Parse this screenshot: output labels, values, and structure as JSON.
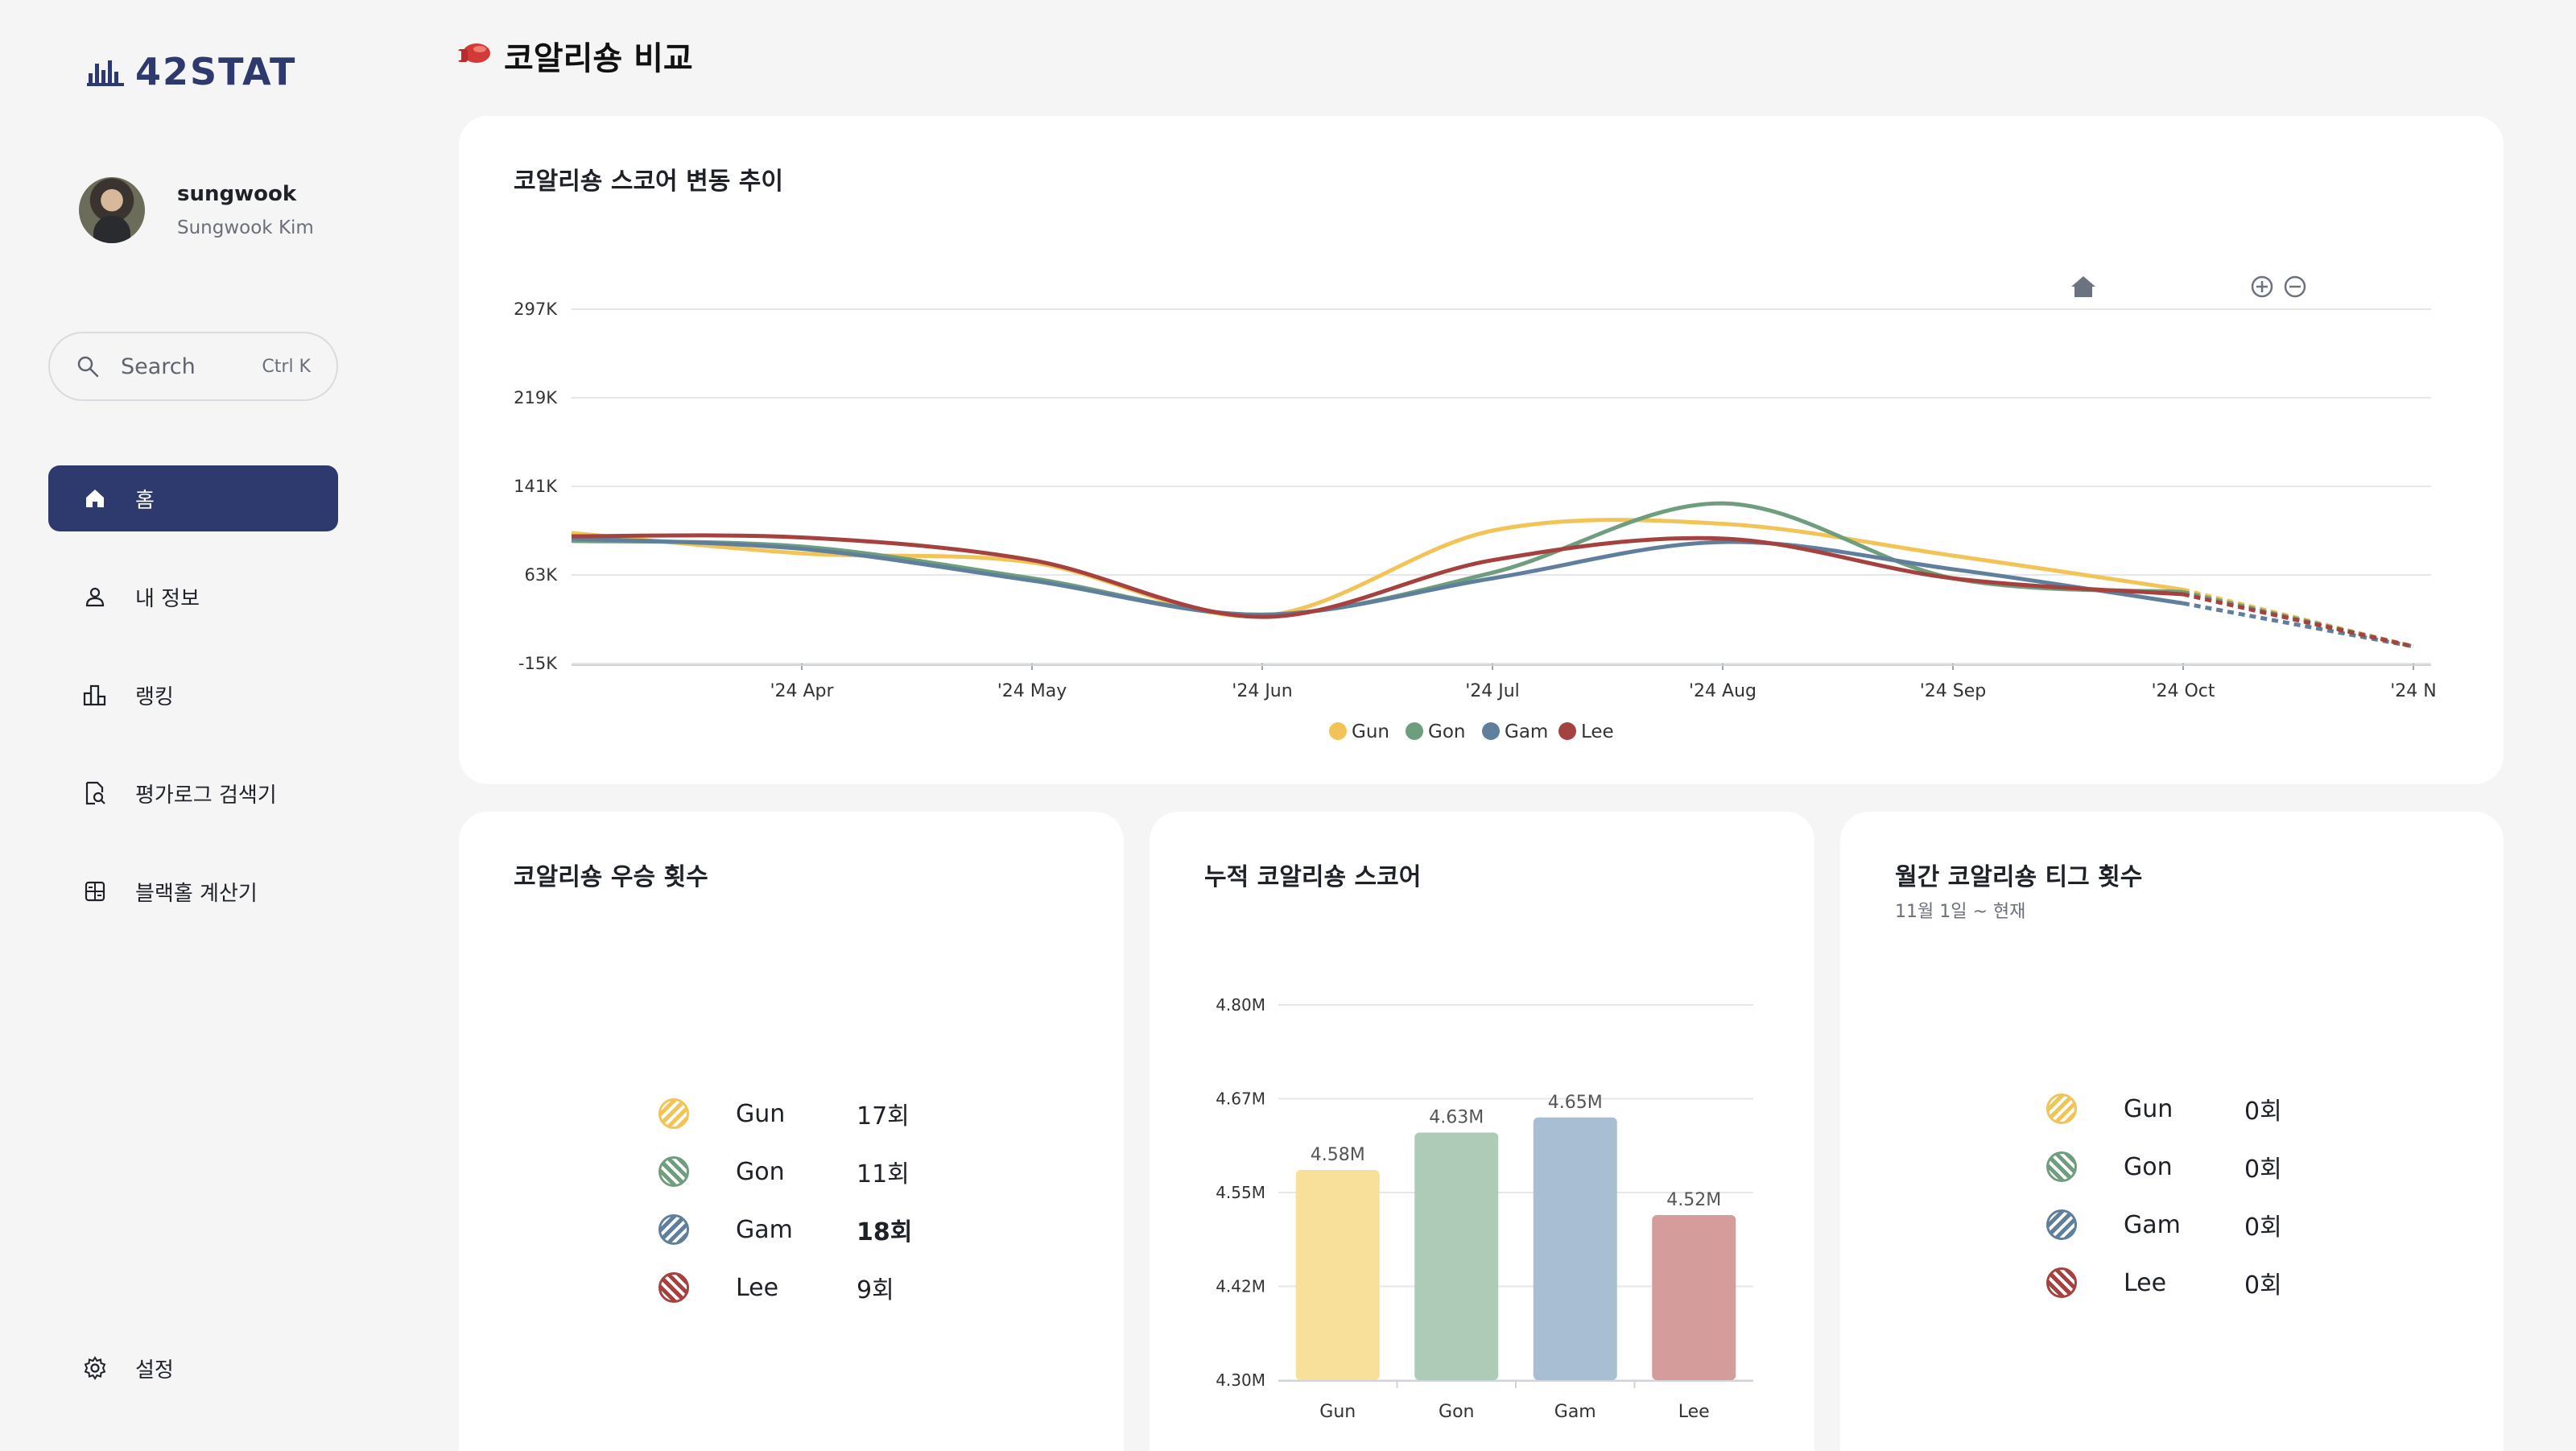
{
  "brand": {
    "name": "42STAT"
  },
  "profile": {
    "username": "sungwook",
    "fullname": "Sungwook Kim"
  },
  "search": {
    "label": "Search",
    "shortcut": "Ctrl K"
  },
  "nav": [
    {
      "label": "홈",
      "icon": "home-icon",
      "active": true
    },
    {
      "label": "내 정보",
      "icon": "user-icon",
      "active": false
    },
    {
      "label": "랭킹",
      "icon": "ranking-icon",
      "active": false
    },
    {
      "label": "평가로그 검색기",
      "icon": "log-search-icon",
      "active": false
    },
    {
      "label": "블랙홀 계산기",
      "icon": "calculator-icon",
      "active": false
    }
  ],
  "settings": {
    "label": "설정",
    "icon": "gear-icon"
  },
  "page": {
    "title": "코알리숑 비교",
    "icon": "boxing-glove-icon"
  },
  "colors": {
    "Gun": "#f2c457",
    "Gon": "#6f9e7e",
    "Gam": "#5f7f9c",
    "Lee": "#a5413e",
    "accent": "#2e3a6e"
  },
  "trend_card": {
    "title": "코알리숑 스코어 변동 추이",
    "toolbar": {
      "zoom_in": "zoom-in-icon",
      "zoom_out": "zoom-out-icon",
      "reset": "home-icon"
    }
  },
  "wins_card": {
    "title": "코알리숑 우승 횟수",
    "rows": [
      {
        "name": "Gun",
        "value": "17회",
        "bold": false
      },
      {
        "name": "Gon",
        "value": "11회",
        "bold": false
      },
      {
        "name": "Gam",
        "value": "18회",
        "bold": true
      },
      {
        "name": "Lee",
        "value": "9회",
        "bold": false
      }
    ]
  },
  "score_card": {
    "title": "누적 코알리숑 스코어"
  },
  "tig_card": {
    "title": "월간 코알리숑 티그 횟수",
    "subtitle": "11월 1일 ~ 현재",
    "rows": [
      {
        "name": "Gun",
        "value": "0회"
      },
      {
        "name": "Gon",
        "value": "0회"
      },
      {
        "name": "Gam",
        "value": "0회"
      },
      {
        "name": "Lee",
        "value": "0회"
      }
    ]
  },
  "chart_data": [
    {
      "type": "line",
      "title": "코알리숑 스코어 변동 추이",
      "x_tick_labels": [
        "'24 Apr",
        "'24 May",
        "'24 Jun",
        "'24 Jul",
        "'24 Aug",
        "'24 Sep",
        "'24 Oct",
        "'24 N"
      ],
      "y_tick_labels": [
        "297K",
        "219K",
        "141K",
        "63K",
        "-15K"
      ],
      "ylim": [
        -15000,
        297000
      ],
      "grid": true,
      "legend": "bottom",
      "x": [
        "2024-03-01",
        "2024-04-01",
        "2024-05-01",
        "2024-06-01",
        "2024-07-01",
        "2024-08-01",
        "2024-09-01",
        "2024-10-01",
        "2024-11-01"
      ],
      "projected_from_index": 7,
      "series": [
        {
          "name": "Gun",
          "values": [
            100000,
            82000,
            74000,
            27000,
            102000,
            108000,
            80000,
            50000,
            0
          ]
        },
        {
          "name": "Gon",
          "values": [
            93000,
            88000,
            60000,
            28000,
            65000,
            126000,
            60000,
            48000,
            0
          ]
        },
        {
          "name": "Gam",
          "values": [
            95000,
            86000,
            58000,
            28000,
            60000,
            92000,
            68000,
            38000,
            0
          ]
        },
        {
          "name": "Lee",
          "values": [
            97000,
            96000,
            76000,
            26000,
            76000,
            95000,
            60000,
            46000,
            0
          ]
        }
      ]
    },
    {
      "type": "bar",
      "title": "누적 코알리숑 스코어",
      "categories": [
        "Gun",
        "Gon",
        "Gam",
        "Lee"
      ],
      "values": [
        4.58,
        4.63,
        4.65,
        4.52
      ],
      "data_labels": [
        "4.58M",
        "4.63M",
        "4.65M",
        "4.52M"
      ],
      "y_tick_labels": [
        "4.80M",
        "4.67M",
        "4.55M",
        "4.42M",
        "4.30M"
      ],
      "ylim": [
        4.3,
        4.8
      ],
      "unit": "M",
      "grid": true
    }
  ]
}
